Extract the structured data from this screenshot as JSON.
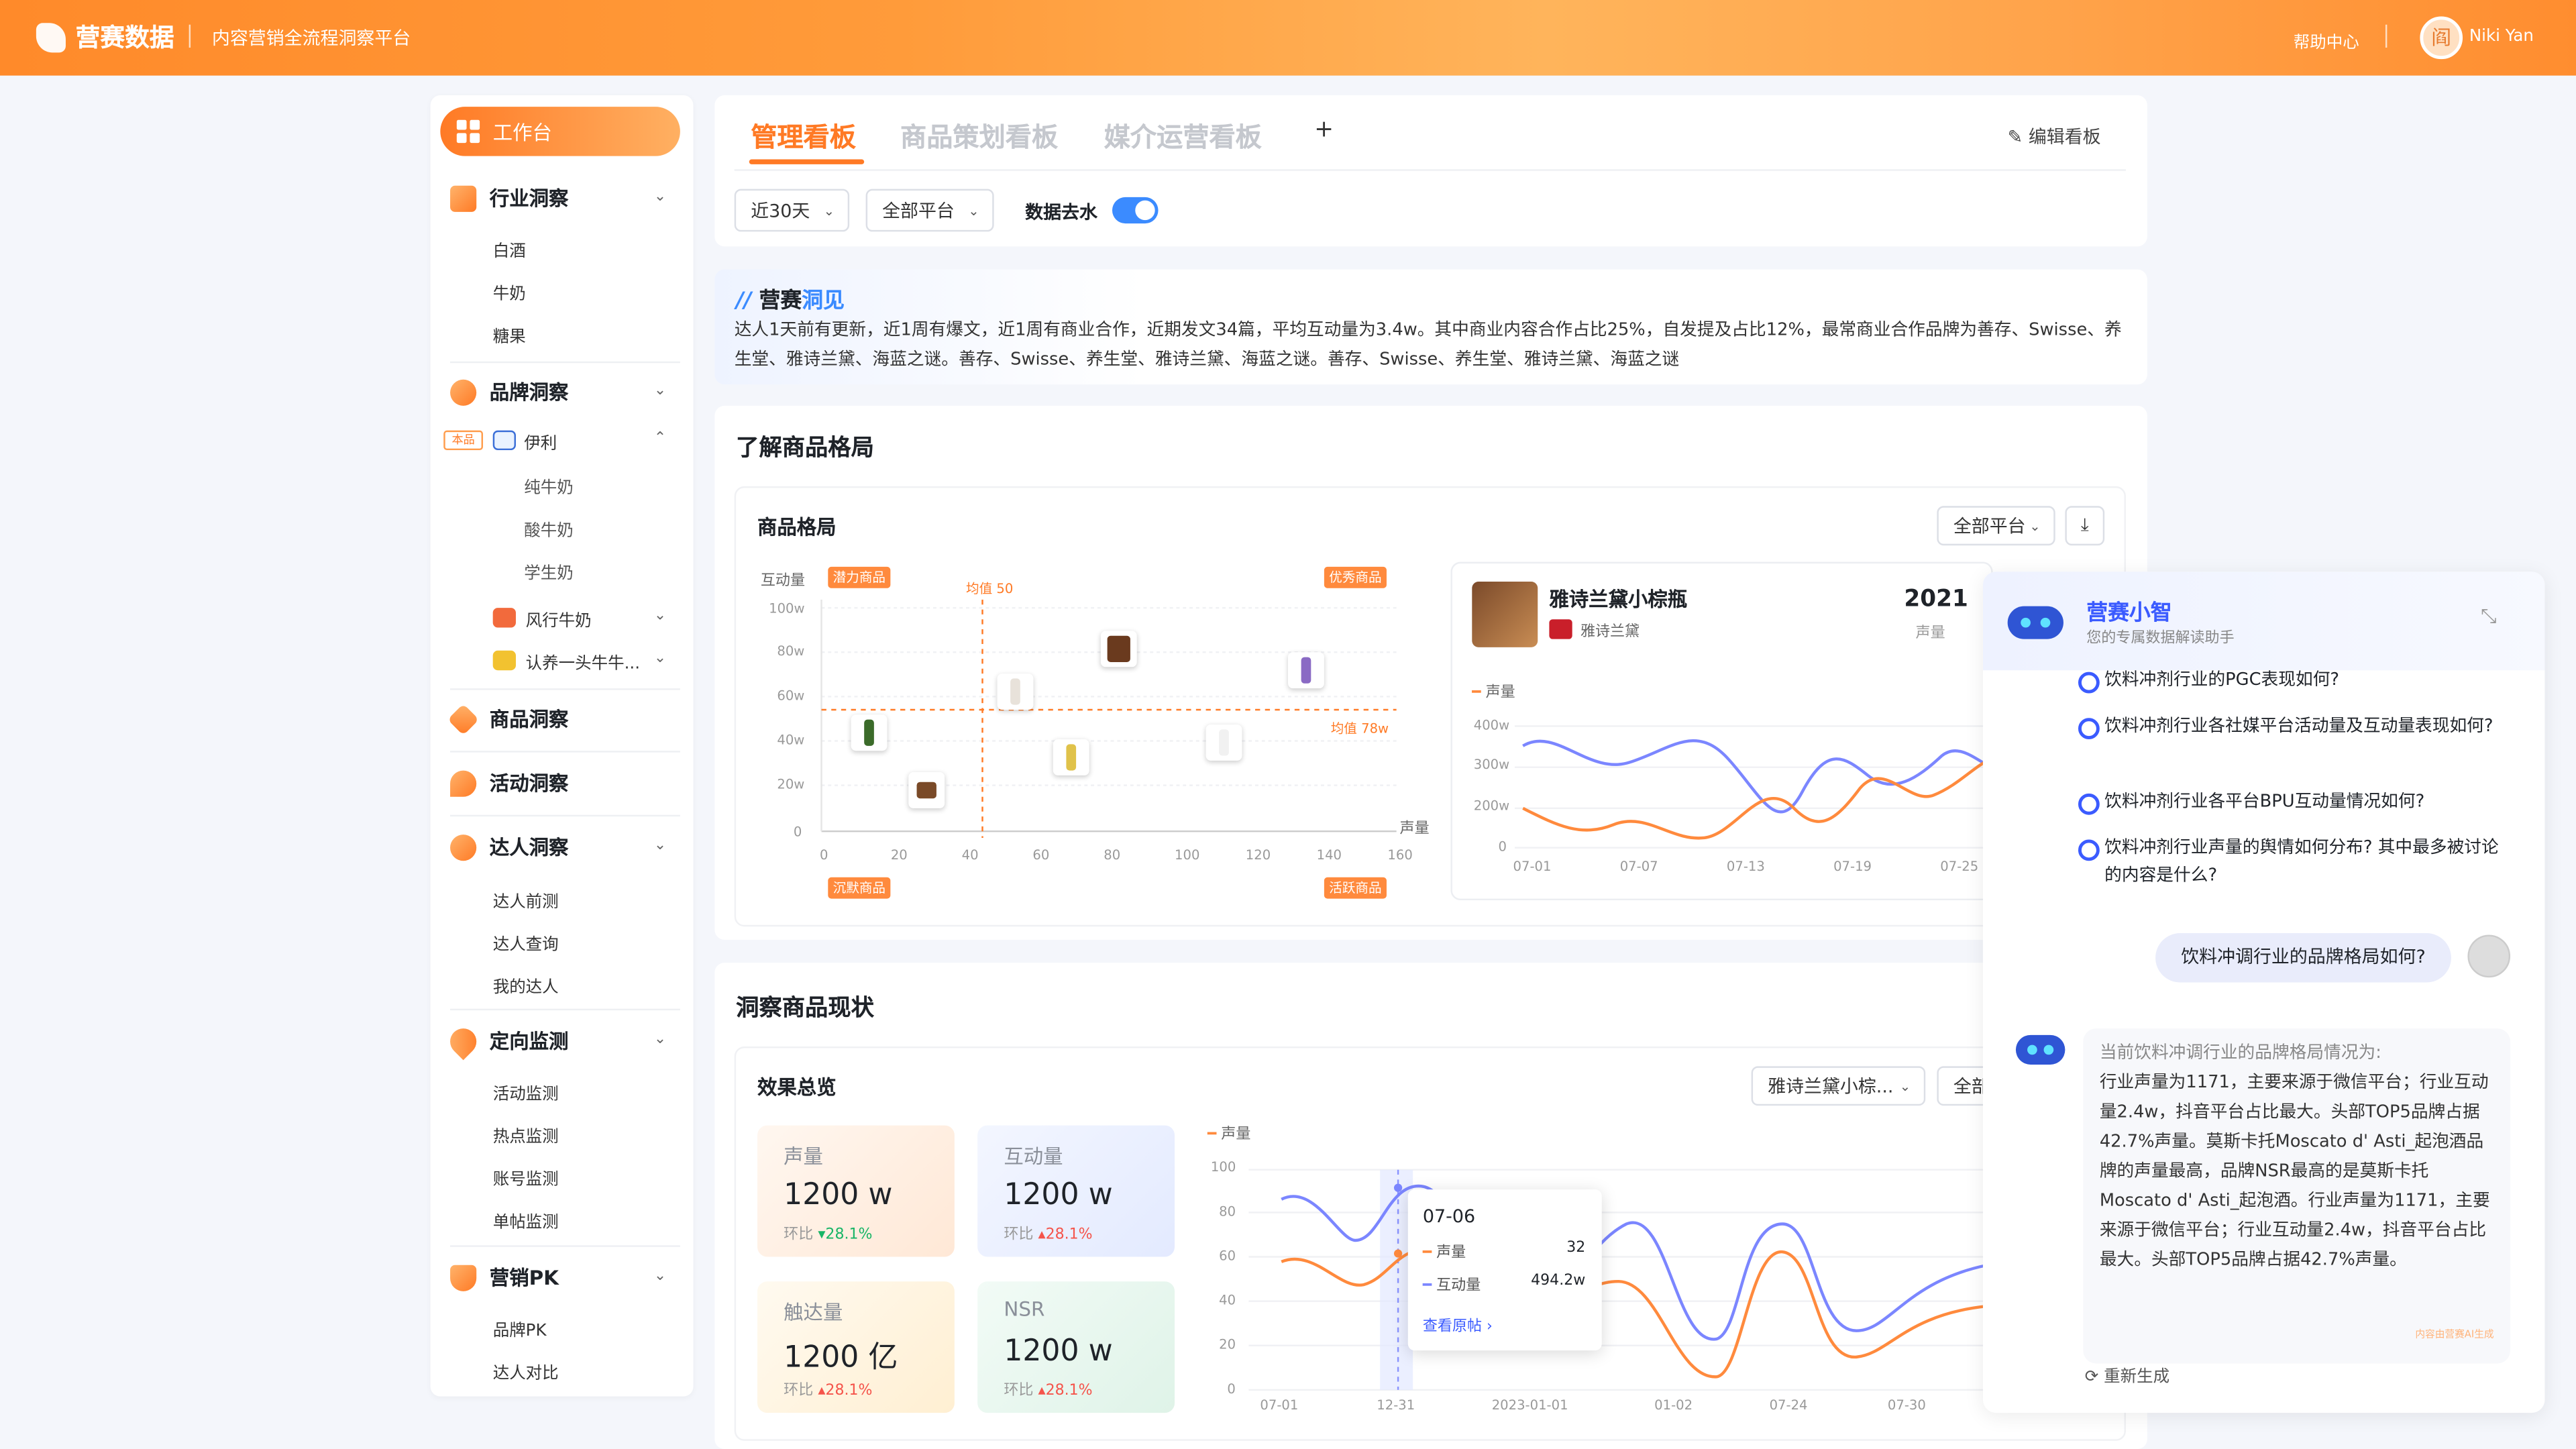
{
  "header": {
    "logo": "营赛数据",
    "subtitle": "内容营销全流程洞察平台",
    "help": "帮助中心",
    "avatar_char": "阎",
    "user": "Niki Yan"
  },
  "sidebar": {
    "workbench": "工作台",
    "sections": [
      {
        "label": "行业洞察",
        "items": [
          "白酒",
          "牛奶",
          "糖果"
        ]
      },
      {
        "label": "品牌洞察",
        "own_tag": "本品",
        "brands": [
          {
            "label": "伊利",
            "items": [
              "纯牛奶",
              "酸牛奶",
              "学生奶"
            ]
          },
          {
            "label": "风行牛奶"
          },
          {
            "label": "认养一头牛牛..."
          }
        ]
      },
      {
        "label": "商品洞察"
      },
      {
        "label": "活动洞察"
      },
      {
        "label": "达人洞察",
        "items": [
          "达人前测",
          "达人查询",
          "我的达人"
        ]
      },
      {
        "label": "定向监测",
        "items": [
          "活动监测",
          "热点监测",
          "账号监测",
          "单帖监测"
        ]
      },
      {
        "label": "营销PK",
        "items": [
          "品牌PK",
          "达人对比"
        ]
      }
    ]
  },
  "tabs": [
    "管理看板",
    "商品策划看板",
    "媒介运营看板"
  ],
  "plus": "+",
  "edit_board": "编辑看板",
  "filters": {
    "period": "近30天",
    "platform": "全部平台",
    "dewater_label": "数据去水",
    "dewater_on": true
  },
  "insight": {
    "title_a": "营赛",
    "title_b": "洞见",
    "body": "达人1天前有更新，近1周有爆文，近1周有商业合作，近期发文34篇，平均互动量为3.4w。其中商业内容合作占比25%，自发提及占比12%，最常商业合作品牌为善存、Swisse、养生堂、雅诗兰黛、海蓝之谜。善存、Swisse、养生堂、雅诗兰黛、海蓝之谜。善存、Swisse、养生堂、雅诗兰黛、海蓝之谜"
  },
  "section1": {
    "title": "了解商品格局",
    "card_title": "商品格局",
    "platform": "全部平台"
  },
  "scatter": {
    "y_label": "互动量",
    "x_label": "声量",
    "quadrants": {
      "tl": "潜力商品",
      "tr": "优秀商品",
      "bl": "沉默商品",
      "br": "活跃商品"
    },
    "avg_x_label": "均值 50",
    "avg_y_label": "均值 78w",
    "y_ticks": [
      "100w",
      "80w",
      "60w",
      "40w",
      "20w",
      "0"
    ],
    "x_ticks": [
      "0",
      "20",
      "40",
      "60",
      "80",
      "100",
      "120",
      "140",
      "160"
    ]
  },
  "product_panel": {
    "name": "雅诗兰黛小棕瓶",
    "brand": "雅诗兰黛",
    "value": "2021",
    "value_label": "声量",
    "legend": "声量",
    "y_ticks": [
      "400w",
      "300w",
      "200w",
      "0"
    ],
    "x_ticks": [
      "07-01",
      "07-07",
      "07-13",
      "07-19",
      "07-25"
    ]
  },
  "section2": {
    "title": "洞察商品现状",
    "card_title": "效果总览",
    "product_select": "雅诗兰黛小棕...",
    "platform_select": "全部"
  },
  "metrics": [
    {
      "label": "声量",
      "value": "1200",
      "unit": "w",
      "change_label": "环比",
      "change": "28.1%",
      "dir": "down"
    },
    {
      "label": "互动量",
      "value": "1200",
      "unit": "w",
      "change_label": "环比",
      "change": "28.1%",
      "dir": "up"
    },
    {
      "label": "触达量",
      "value": "1200",
      "unit": "亿",
      "change_label": "环比",
      "change": "28.1%",
      "dir": "up"
    },
    {
      "label": "NSR",
      "value": "1200",
      "unit": "w",
      "change_label": "环比",
      "change": "28.1%",
      "dir": "up"
    }
  ],
  "trend": {
    "legend": "声量",
    "y_ticks": [
      "100",
      "80",
      "60",
      "40",
      "20",
      "0"
    ],
    "x_ticks": [
      "07-01",
      "12-31",
      "2023-01-01",
      "01-02",
      "07-24",
      "07-30"
    ],
    "tooltip": {
      "date": "07-06",
      "row1_label": "声量",
      "row1_value": "32",
      "row2_label": "互动量",
      "row2_value": "494.2w",
      "link": "查看原帖 ›"
    }
  },
  "assistant": {
    "name": "营赛小智",
    "desc": "您的专属数据解读助手",
    "questions": [
      "饮料冲剂行业的PGC表现如何?",
      "饮料冲剂行业各社媒平台活动量及互动量表现如何?",
      "饮料冲剂行业各平台BPU互动量情况如何?",
      "饮料冲剂行业声量的舆情如何分布? 其中最多被讨论的内容是什么?"
    ],
    "user_msg": "饮料冲调行业的品牌格局如何?",
    "answer_head": "当前饮料冲调行业的品牌格局情况为:",
    "answer": "行业声量为1171，主要来源于微信平台；行业互动量2.4w，抖音平台占比最大。头部TOP5品牌占据42.7%声量。莫斯卡托Moscato d' Asti_起泡酒品牌的声量最高，品牌NSR最高的是莫斯卡托Moscato d' Asti_起泡酒。行业声量为1171，主要来源于微信平台；行业互动量2.4w，抖音平台占比最大。头部TOP5品牌占据42.7%声量。",
    "ai_note": "内容由营赛AI生成",
    "regenerate": "重新生成"
  },
  "colors": {
    "brand": "#ff7a25",
    "blue": "#3b5bff",
    "line_blue": "#6b7cff",
    "line_orange": "#ff8a3d"
  }
}
